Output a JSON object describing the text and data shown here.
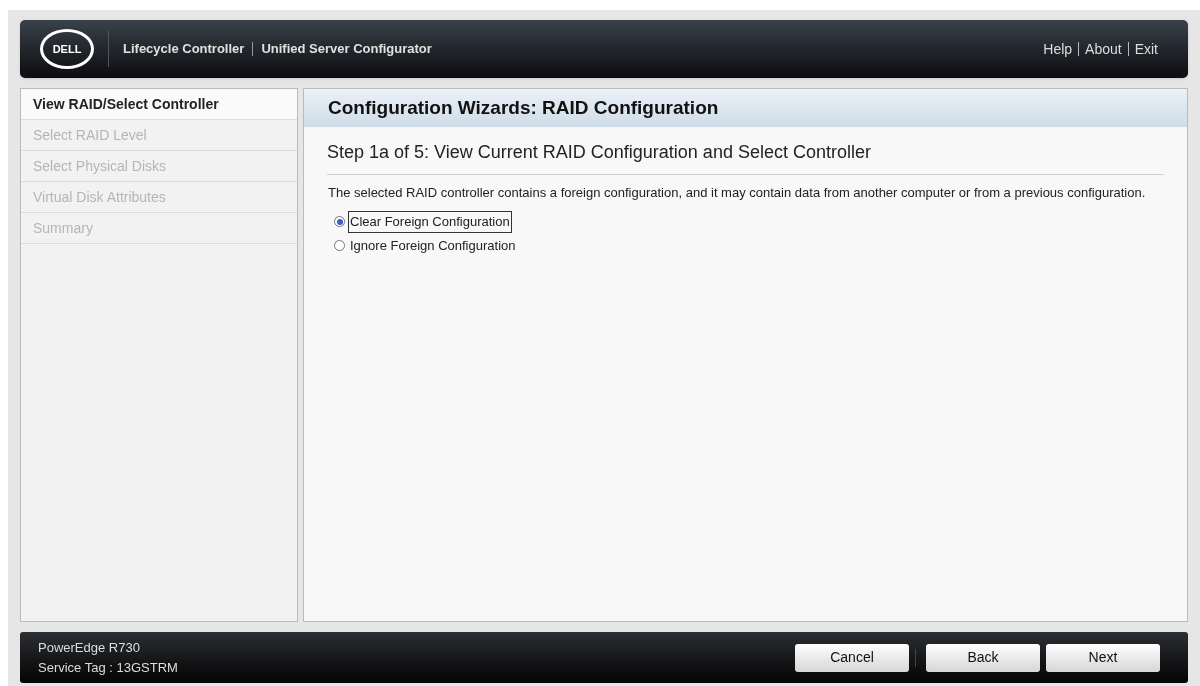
{
  "header": {
    "logo": "DELL",
    "product": "Lifecycle Controller",
    "subtitle": "Unified Server Configurator",
    "links": [
      "Help",
      "About",
      "Exit"
    ]
  },
  "sidebar": {
    "items": [
      {
        "label": "View RAID/Select Controller",
        "selected": true
      },
      {
        "label": "Select RAID Level",
        "selected": false
      },
      {
        "label": "Select Physical Disks",
        "selected": false
      },
      {
        "label": "Virtual Disk Attributes",
        "selected": false
      },
      {
        "label": "Summary",
        "selected": false
      }
    ]
  },
  "main": {
    "title": "Configuration Wizards: RAID Configuration",
    "step": "Step 1a of 5: View Current RAID Configuration and Select Controller",
    "description": "The selected RAID controller contains a foreign configuration, and it may contain data from another computer or from a previous configuration.",
    "options": [
      {
        "label": "Clear Foreign Configuration",
        "selected": true
      },
      {
        "label": "Ignore Foreign Configuration",
        "selected": false
      }
    ]
  },
  "footer": {
    "model": "PowerEdge R730",
    "service_tag": "Service Tag : 13GSTRM",
    "buttons": [
      "Cancel",
      "Back",
      "Next"
    ]
  }
}
